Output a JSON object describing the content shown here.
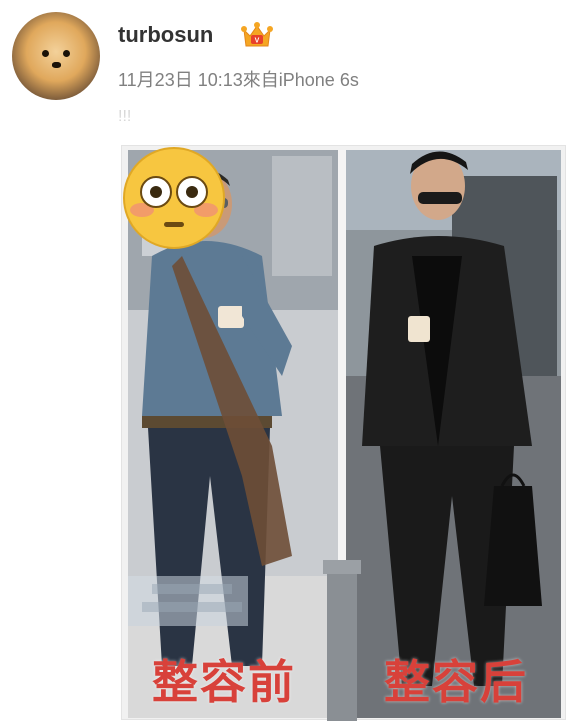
{
  "post": {
    "username": "turbosun",
    "timestamp": "11月23日 10:13",
    "source": "來自iPhone 6s",
    "text": "!!!"
  },
  "image": {
    "caption_before": "整容前",
    "caption_after": "整容后"
  },
  "icons": {
    "vip_badge": "crown-vip-icon",
    "emoji": "flushed-face-emoji"
  },
  "colors": {
    "username": "#333333",
    "meta": "#808080",
    "caption": "#d8413a"
  }
}
